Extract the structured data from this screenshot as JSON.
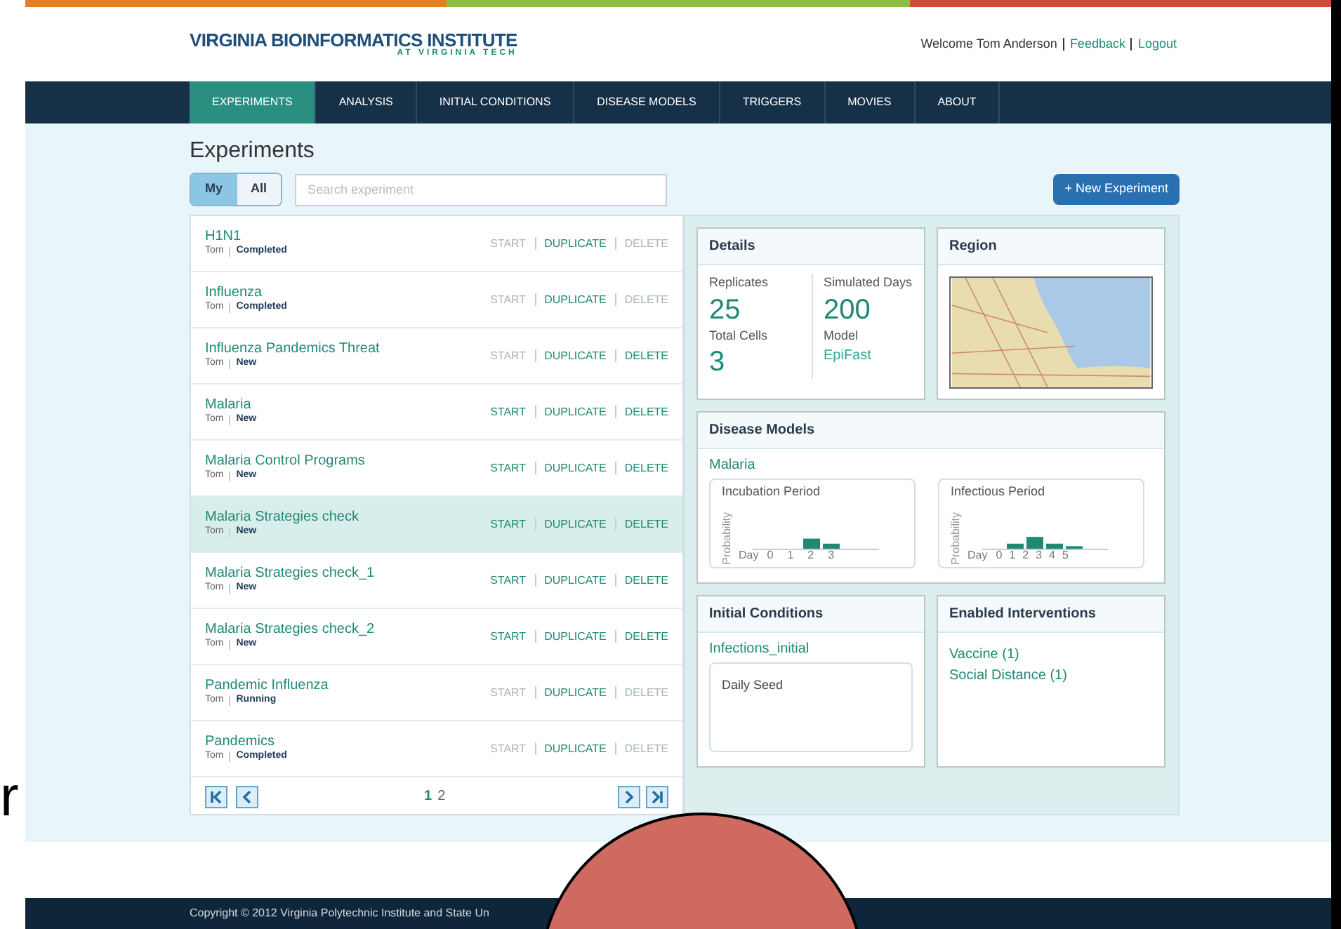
{
  "header": {
    "logo_title": "VIRGINIA BIOINFORMATICS INSTITUTE",
    "logo_subtitle": "AT VIRGINIA TECH",
    "welcome": "Welcome Tom Anderson",
    "links": [
      "Feedback",
      "Logout"
    ]
  },
  "nav": [
    {
      "label": "EXPERIMENTS",
      "selected": true
    },
    {
      "label": "ANALYSIS",
      "selected": false
    },
    {
      "label": "INITIAL CONDITIONS",
      "selected": false
    },
    {
      "label": "DISEASE MODELS",
      "selected": false
    },
    {
      "label": "TRIGGERS",
      "selected": false
    },
    {
      "label": "MOVIES",
      "selected": false
    },
    {
      "label": "ABOUT",
      "selected": false
    }
  ],
  "page_title": "Experiments",
  "filter": [
    {
      "label": "My",
      "selected": true
    },
    {
      "label": "All",
      "selected": false
    }
  ],
  "search": {
    "placeholder": "Search experiment"
  },
  "new_button": "+ New Experiment",
  "experiments": [
    {
      "name": "H1N1",
      "owner": "Tom",
      "status": "Completed",
      "selected": false,
      "actions": [
        {
          "label": "START",
          "disabled": true
        },
        {
          "label": "DUPLICATE",
          "disabled": false
        },
        {
          "label": "DELETE",
          "disabled": true
        }
      ]
    },
    {
      "name": "Influenza",
      "owner": "Tom",
      "status": "Completed",
      "selected": false,
      "actions": [
        {
          "label": "START",
          "disabled": true
        },
        {
          "label": "DUPLICATE",
          "disabled": false
        },
        {
          "label": "DELETE",
          "disabled": true
        }
      ]
    },
    {
      "name": "Influenza Pandemics Threat",
      "owner": "Tom",
      "status": "New",
      "selected": false,
      "actions": [
        {
          "label": "START",
          "disabled": true
        },
        {
          "label": "DUPLICATE",
          "disabled": false
        },
        {
          "label": "DELETE",
          "disabled": false
        }
      ]
    },
    {
      "name": "Malaria",
      "owner": "Tom",
      "status": "New",
      "selected": false,
      "actions": [
        {
          "label": "START",
          "disabled": false
        },
        {
          "label": "DUPLICATE",
          "disabled": false
        },
        {
          "label": "DELETE",
          "disabled": false
        }
      ]
    },
    {
      "name": "Malaria Control Programs",
      "owner": "Tom",
      "status": "New",
      "selected": false,
      "actions": [
        {
          "label": "START",
          "disabled": false
        },
        {
          "label": "DUPLICATE",
          "disabled": false
        },
        {
          "label": "DELETE",
          "disabled": false
        }
      ]
    },
    {
      "name": "Malaria Strategies check",
      "owner": "Tom",
      "status": "New",
      "selected": true,
      "actions": [
        {
          "label": "START",
          "disabled": false
        },
        {
          "label": "DUPLICATE",
          "disabled": false
        },
        {
          "label": "DELETE",
          "disabled": false
        }
      ]
    },
    {
      "name": "Malaria Strategies check_1",
      "owner": "Tom",
      "status": "New",
      "selected": false,
      "actions": [
        {
          "label": "START",
          "disabled": false
        },
        {
          "label": "DUPLICATE",
          "disabled": false
        },
        {
          "label": "DELETE",
          "disabled": false
        }
      ]
    },
    {
      "name": "Malaria Strategies check_2",
      "owner": "Tom",
      "status": "New",
      "selected": false,
      "actions": [
        {
          "label": "START",
          "disabled": false
        },
        {
          "label": "DUPLICATE",
          "disabled": false
        },
        {
          "label": "DELETE",
          "disabled": false
        }
      ]
    },
    {
      "name": "Pandemic Influenza",
      "owner": "Tom",
      "status": "Running",
      "selected": false,
      "actions": [
        {
          "label": "START",
          "disabled": true
        },
        {
          "label": "DUPLICATE",
          "disabled": false
        },
        {
          "label": "DELETE",
          "disabled": true
        }
      ]
    },
    {
      "name": "Pandemics",
      "owner": "Tom",
      "status": "Completed",
      "selected": false,
      "actions": [
        {
          "label": "START",
          "disabled": true
        },
        {
          "label": "DUPLICATE",
          "disabled": false
        },
        {
          "label": "DELETE",
          "disabled": true
        }
      ]
    }
  ],
  "pagination": {
    "pages": [
      {
        "label": "1",
        "selected": true
      },
      {
        "label": "2",
        "selected": false
      }
    ]
  },
  "details": {
    "title": "Details",
    "fields": [
      {
        "label": "Replicates",
        "value": "25",
        "kind": "number"
      },
      {
        "label": "Simulated Days",
        "value": "200",
        "kind": "number"
      },
      {
        "label": "Total Cells",
        "value": "3",
        "kind": "number"
      },
      {
        "label": "Model",
        "value": "EpiFast",
        "kind": "link"
      }
    ]
  },
  "region": {
    "title": "Region"
  },
  "disease_models": {
    "title": "Disease Models",
    "model": "Malaria",
    "charts": [
      {
        "title": "Incubation Period",
        "ylabel": "Probability",
        "xlabel": "Day",
        "x_labels": [
          "0",
          "1",
          "2",
          "3"
        ]
      },
      {
        "title": "Infectious Period",
        "ylabel": "Probability",
        "xlabel": "Day",
        "x_labels": [
          "0",
          "1",
          "2",
          "3",
          "4",
          "5"
        ]
      }
    ]
  },
  "initial_conditions": {
    "title": "Initial Conditions",
    "name": "Infections_initial",
    "box_label": "Daily Seed"
  },
  "interventions": {
    "title": "Enabled Interventions",
    "items": [
      "Vaccine (1)",
      "Social Distance (1)"
    ]
  },
  "footer": {
    "text": "Copyright © 2012 Virginia Polytechnic Institute and State Un"
  },
  "overlay_text": "r"
}
